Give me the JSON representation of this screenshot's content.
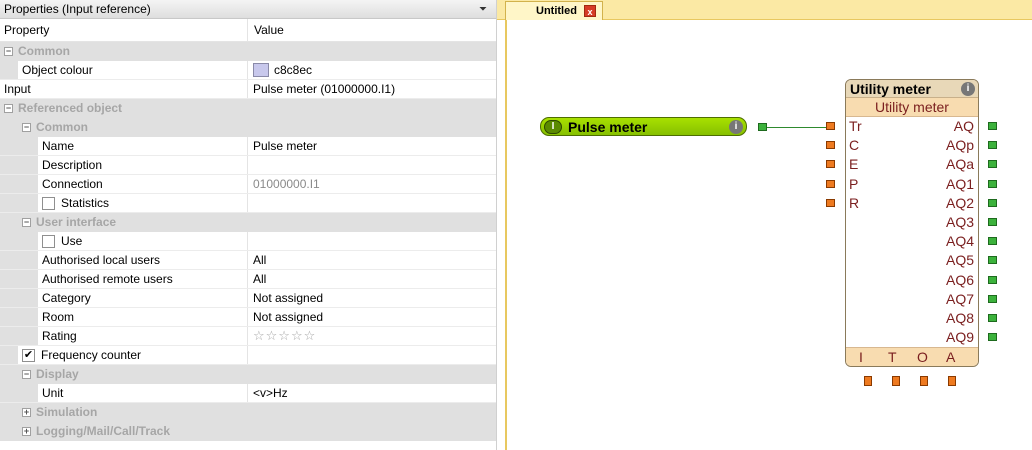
{
  "panel": {
    "title": "Properties (Input reference)",
    "header": {
      "property": "Property",
      "value": "Value"
    },
    "rows": [
      {
        "kind": "group",
        "level": 0,
        "label": "Common",
        "exp": "−"
      },
      {
        "kind": "prop",
        "level": 1,
        "label": "Object colour",
        "value": "c8c8ec",
        "swatch": "#c8c8ec"
      },
      {
        "kind": "prop",
        "level": 0,
        "label": "Input",
        "value": "Pulse meter (01000000.I1)"
      },
      {
        "kind": "group",
        "level": 0,
        "label": "Referenced object",
        "exp": "−"
      },
      {
        "kind": "group",
        "level": 1,
        "label": "Common",
        "exp": "−"
      },
      {
        "kind": "prop",
        "level": 2,
        "label": "Name",
        "value": "Pulse meter"
      },
      {
        "kind": "prop",
        "level": 2,
        "label": "Description",
        "value": ""
      },
      {
        "kind": "prop",
        "level": 2,
        "label": "Connection",
        "value": "01000000.I1",
        "disabled": true
      },
      {
        "kind": "check",
        "level": 2,
        "label": "Statistics",
        "checked": false
      },
      {
        "kind": "group",
        "level": 1,
        "label": "User interface",
        "exp": "−"
      },
      {
        "kind": "check",
        "level": 2,
        "label": "Use",
        "checked": false
      },
      {
        "kind": "prop",
        "level": 2,
        "label": "Authorised local users",
        "value": "All"
      },
      {
        "kind": "prop",
        "level": 2,
        "label": "Authorised remote users",
        "value": "All"
      },
      {
        "kind": "prop",
        "level": 2,
        "label": "Category",
        "value": "Not assigned"
      },
      {
        "kind": "prop",
        "level": 2,
        "label": "Room",
        "value": "Not assigned"
      },
      {
        "kind": "prop",
        "level": 2,
        "label": "Rating",
        "stars": "☆☆☆☆☆"
      },
      {
        "kind": "check",
        "level": 1,
        "label": "Frequency counter",
        "checked": true
      },
      {
        "kind": "group",
        "level": 1,
        "label": "Display",
        "exp": "−"
      },
      {
        "kind": "prop",
        "level": 2,
        "label": "Unit",
        "value": "<v>Hz"
      },
      {
        "kind": "group",
        "level": 1,
        "label": "Simulation",
        "exp": "+"
      },
      {
        "kind": "group",
        "level": 1,
        "label": "Logging/Mail/Call/Track",
        "exp": "+"
      }
    ]
  },
  "editor": {
    "tab_label": "Untitled",
    "tab_close": "x",
    "pulse_block": {
      "badge": "I",
      "name": "Pulse meter",
      "info": "i"
    },
    "utility_meter": {
      "title": "Utility meter",
      "subtitle": "Utility meter",
      "info": "i",
      "inputs": [
        "Tr",
        "C",
        "E",
        "P",
        "R"
      ],
      "outputs": [
        "AQ",
        "AQp",
        "AQa",
        "AQ1",
        "AQ2",
        "AQ3",
        "AQ4",
        "AQ5",
        "AQ6",
        "AQ7",
        "AQ8",
        "AQ9"
      ],
      "footer": [
        "I",
        "T",
        "O",
        "A"
      ]
    }
  }
}
